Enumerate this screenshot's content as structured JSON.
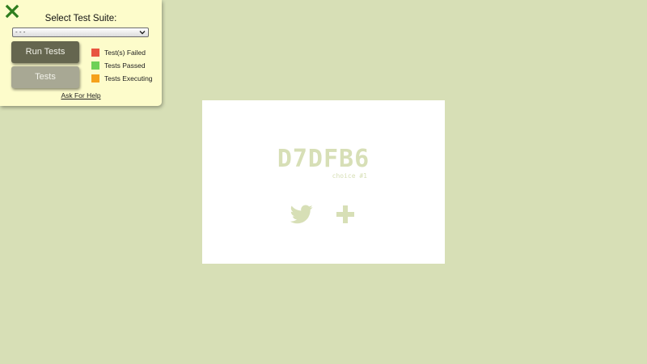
{
  "panel": {
    "title": "Select Test Suite:",
    "suite_select": {
      "value": "- - -"
    },
    "run_button_label": "Run Tests",
    "tests_button_label": "Tests",
    "legend": [
      {
        "label": "Test(s) Failed",
        "color": "#e8553f"
      },
      {
        "label": "Tests Passed",
        "color": "#6ed157"
      },
      {
        "label": "Tests Executing",
        "color": "#f5a11c"
      }
    ],
    "help_link": "Ask For Help",
    "close_icon": "close-x-icon",
    "accent_color": "#2e7d1e"
  },
  "card": {
    "hex": "D7DFB6",
    "choice": "choice #1",
    "icons": [
      "twitter-icon",
      "plus-icon"
    ],
    "foreground": "#d7dfb6"
  },
  "page": {
    "background": "#d7dfb6"
  }
}
